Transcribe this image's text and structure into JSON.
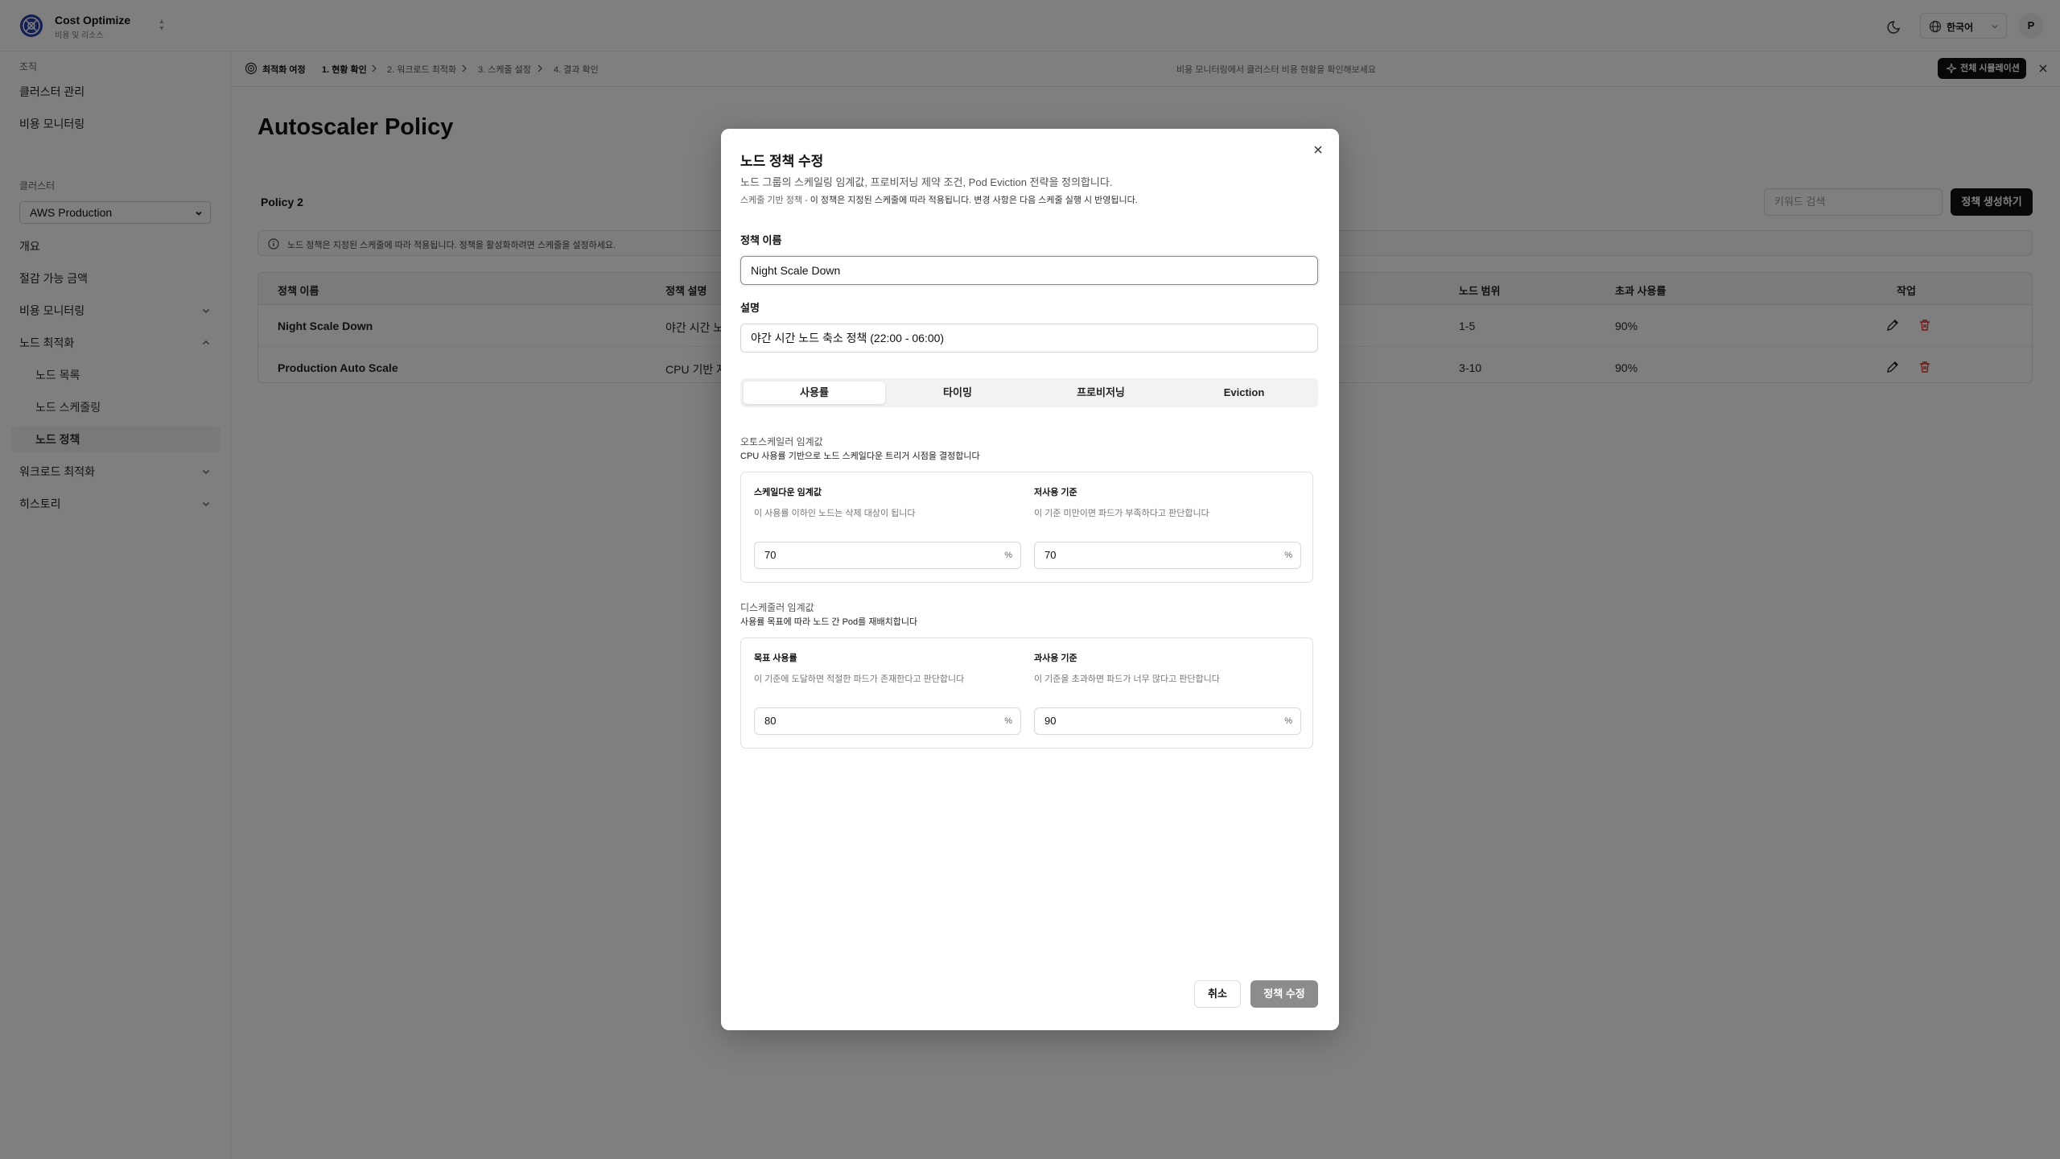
{
  "brand": {
    "title": "Cost Optimize",
    "subtitle": "비용 및 리소스"
  },
  "header": {
    "language": "한국어",
    "avatar_initial": "P"
  },
  "sidebar": {
    "org_label": "조직",
    "org_items": [
      "클러스터 관리",
      "비용 모니터링"
    ],
    "cluster_label": "클러스터",
    "cluster_selected": "AWS Production",
    "menu": {
      "overview": "개요",
      "savings": "절감 가능 금액",
      "cost_monitoring": "비용 모니터링",
      "node_optimization": "노드 최적화",
      "node_list": "노드 목록",
      "node_scaling": "노드 스케줄링",
      "node_policy": "노드 정책",
      "workload_optimization": "워크로드 최적화",
      "history": "히스토리"
    }
  },
  "breadcrumb": {
    "journey": "최적화 여정",
    "step1": "1. 현황 확인",
    "step2": "2. 워크로드 최적화",
    "step3": "3. 스케줄 설정",
    "step4": "4. 결과 확인",
    "hint": "비용 모니터링에서 클러스터 비용 현황을 확인해보세요",
    "sim_button": "전체 시뮬레이션"
  },
  "page": {
    "title": "Autoscaler Policy",
    "policy_count": "Policy 2",
    "search_placeholder": "키워드 검색",
    "create_button": "정책 생성하기",
    "notice": "노드 정책은 지정된 스케줄에 따라 적용됩니다. 정책을 활성화하려면 스케줄을 설정하세요."
  },
  "table": {
    "headers": {
      "name": "정책 이름",
      "desc": "정책 설명",
      "range": "노드 범위",
      "over": "초과 사용률",
      "action": "작업"
    },
    "rows": [
      {
        "name": "Night Scale Down",
        "desc": "야간 시간 노",
        "range": "1-5",
        "over": "90%"
      },
      {
        "name": "Production Auto Scale",
        "desc": "CPU 기반 자",
        "range": "3-10",
        "over": "90%"
      }
    ]
  },
  "modal": {
    "title": "노드 정책 수정",
    "description": "노드 그룹의 스케일링 임계값, 프로비저닝 제약 조건, Pod Eviction 전략을 정의합니다.",
    "note_prefix": "스케줄 기반 정책 - ",
    "note_text": "이 정책은 지정된 스케줄에 따라 적용됩니다. 변경 사항은 다음 스케줄 실행 시 반영됩니다.",
    "name_label": "정책 이름",
    "name_value": "Night Scale Down",
    "desc_label": "설명",
    "desc_value": "야간 시간 노드 축소 정책 (22:00 - 06:00)",
    "tabs": [
      "사용률",
      "타이밍",
      "프로비저닝",
      "Eviction"
    ],
    "autoscaler": {
      "title": "오토스케일러 임계값",
      "desc": "CPU 사용률 기반으로 노드 스케일다운 트리거 시점을 결정합니다",
      "scaledown_label": "스케일다운 임계값",
      "scaledown_hint": "이 사용률 이하인 노드는 삭제 대상이 됩니다",
      "scaledown_value": "70",
      "low_label": "저사용 기준",
      "low_hint": "이 기준 미만이면 파드가 부족하다고 판단합니다",
      "low_value": "70",
      "unit": "%"
    },
    "descheduler": {
      "title": "디스케줄러 임계값",
      "desc": "사용률 목표에 따라 노드 간 Pod를 재배치합니다",
      "target_label": "목표 사용률",
      "target_hint": "이 기준에 도달하면 적절한 파드가 존재한다고 판단합니다",
      "target_value": "80",
      "over_label": "과사용 기준",
      "over_hint": "이 기준을 초과하면 파드가 너무 많다고 판단합니다",
      "over_value": "90",
      "unit": "%"
    },
    "cancel": "취소",
    "submit": "정책 수정"
  }
}
